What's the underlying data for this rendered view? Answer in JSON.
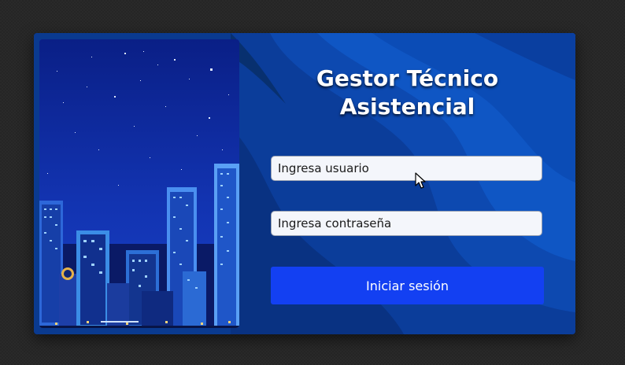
{
  "app": {
    "title_line1": "Gestor Técnico",
    "title_line2": "Asistencial"
  },
  "login": {
    "user_placeholder": "Ingresa usuario",
    "password_placeholder": "Ingresa contraseña",
    "submit_label": "Iniciar sesión"
  },
  "theme": {
    "accent": "#1340f2",
    "card_bg": "#062a70",
    "page_bg": "#252525"
  },
  "icons": {
    "cursor": "mouse-pointer-icon"
  }
}
